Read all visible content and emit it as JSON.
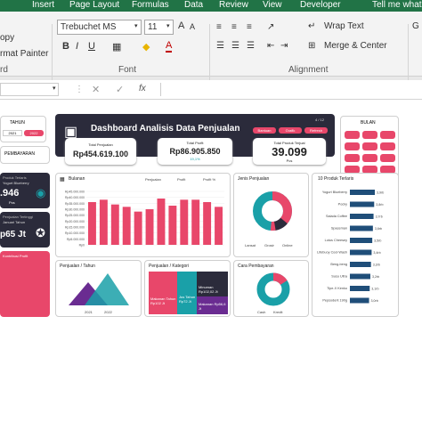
{
  "tabs": [
    "Insert",
    "Page Layout",
    "Formulas",
    "Data",
    "Review",
    "View",
    "Developer",
    "Tell me what"
  ],
  "ribbon": {
    "paste_fragment": "opy",
    "format_painter": "rmat Painter",
    "clipboard_fragment": "rd",
    "font_name": "Trebuchet MS",
    "font_size": "11",
    "font_group": "Font",
    "wrap_text": "Wrap Text",
    "merge_center": "Merge & Center",
    "alignment_group": "Alignment",
    "bold": "B",
    "italic": "I",
    "underline": "U",
    "grow_font": "A",
    "shrink_font": "A",
    "font_color": "A"
  },
  "colors": {
    "pink": "#e8476a",
    "teal": "#1aa0a8",
    "dark": "#2b2b3b",
    "green": "#217346",
    "purple": "#6a2c91"
  },
  "dashboard": {
    "title": "Dashboard Analisis Data Penjualan",
    "header_buttons": [
      "Bantuan",
      "Grafik",
      "Refresh"
    ],
    "version": "4 / 12",
    "tahun": {
      "label": "TAHUN",
      "values": [
        "2021",
        "2022"
      ]
    },
    "pembayaran": {
      "label": "PEMBAYARAN"
    },
    "bulan": {
      "label": "BULAN"
    },
    "kpis": [
      {
        "label": "Total Penjualan",
        "value": "Rp454.619.100",
        "sub": ""
      },
      {
        "label": "Total Profit",
        "value": "Rp86.905.850",
        "sub": "19,1%"
      },
      {
        "label": "Total Produk Terjual",
        "value": "39.099",
        "sub": "Pcs"
      }
    ],
    "left_cards": [
      {
        "title": "Produk Terlaris",
        "sub": "Yogurt Blueberry",
        "value": ".946",
        "unit": "Pcs"
      },
      {
        "title": "Penjualan Tertinggi",
        "sub": "Januari Tahun",
        "value": "p65 Jt",
        "unit": ""
      },
      {
        "title": "Kontribusi Profit",
        "sub": "",
        "value": "",
        "unit": ""
      }
    ],
    "panels": {
      "bulanan": "Bulanan",
      "jenis": "Jenis Penjualan",
      "top10": "10 Produk Terlaris",
      "tahun": "Penjualan / Tahun",
      "kategori": "Penjualan / Kategori",
      "cara": "Cara Pembayaran"
    },
    "legend_bulanan": [
      "Penjualan",
      "Profit",
      "Profit %"
    ],
    "pie_legend_jenis": [
      "Lansat",
      "Grosir",
      "Online"
    ],
    "pie_legend_cara": [
      "Cash",
      "Kredit"
    ],
    "tahun_labels": [
      "2021",
      "2022"
    ],
    "kategori_tiles": [
      {
        "name": "Minuman",
        "value": "Rp102,02 Jt"
      },
      {
        "name": "Makanan Tahun Rp102 Jt",
        "value": ""
      },
      {
        "name": "Jus Tahun Rp72 Jt",
        "value": ""
      },
      {
        "name": "Makanan Rp56,6 Jt",
        "value": ""
      }
    ]
  },
  "chart_data": [
    {
      "type": "bar",
      "title": "Bulanan",
      "categories": [
        "Jan",
        "Feb",
        "Mar",
        "Apr",
        "Mei",
        "Jun",
        "Jul",
        "Agu",
        "Sep",
        "Okt",
        "Nov",
        "Des"
      ],
      "ytick_labels": [
        "Rp45.000.000",
        "Rp40.000.000",
        "Rp35.000.000",
        "Rp30.000.000",
        "Rp25.000.000",
        "Rp20.000.000",
        "Rp15.000.000",
        "Rp10.000.000",
        "Rp5.000.000",
        "Rp0"
      ],
      "ylim": [
        0,
        45
      ],
      "values": [
        36,
        38,
        34,
        32,
        28,
        30,
        39,
        33,
        38,
        38,
        36,
        32
      ]
    },
    {
      "type": "bar",
      "title": "10 Produk Terlaris",
      "categories": [
        "Yogurt Blueberry",
        "Pocky",
        "Salada Coffee",
        "Spaceman",
        "Lotus Cheesey",
        "Lifebuoy Cool Wash",
        "Beng-beng",
        "Susu Ultra",
        "Tipe-X Kenko",
        "Pepsodent 190g"
      ],
      "values": [
        3.9,
        3.8,
        3.7,
        3.6,
        3.5,
        3.4,
        3.3,
        3.2,
        3.1,
        3.0
      ],
      "value_labels": [
        "3,9rb",
        "3,8rb",
        "3,7rb",
        "3,6rb",
        "3,5rb",
        "3,4rb",
        "3,3rb",
        "3,2rb",
        "3,1rb",
        "3,0rb"
      ]
    }
  ]
}
